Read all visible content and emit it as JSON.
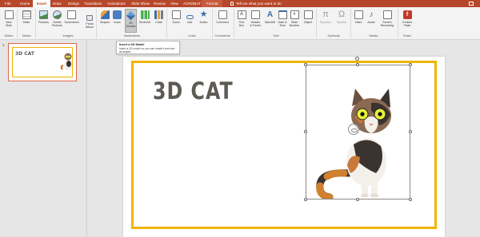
{
  "tabs": [
    {
      "label": "File",
      "active": false
    },
    {
      "label": "Home",
      "active": false
    },
    {
      "label": "Insert",
      "active": true
    },
    {
      "label": "Draw",
      "active": false
    },
    {
      "label": "Design",
      "active": false
    },
    {
      "label": "Transitions",
      "active": false
    },
    {
      "label": "Animations",
      "active": false
    },
    {
      "label": "Slide Show",
      "active": false
    },
    {
      "label": "Review",
      "active": false
    },
    {
      "label": "View",
      "active": false
    },
    {
      "label": "ACROBAT",
      "active": false
    },
    {
      "label": "Format",
      "active": false
    }
  ],
  "tell_me": "Tell me what you want to do",
  "ribbon": {
    "new_slide": "New\nSlide",
    "table": "Table",
    "pictures": "Pictures",
    "online_pictures": "Online\nPictures",
    "screenshot": "Screenshot",
    "photo_album": "Photo\nAlbum",
    "shapes": "Shapes",
    "icons": "Icons",
    "models_3d": "3D\nModels",
    "smartart": "SmartArt",
    "chart": "Chart",
    "zoom": "Zoom",
    "link": "Link",
    "action": "Action",
    "comment": "Comment",
    "text_box": "Text\nBox",
    "header_footer": "Header\n& Footer",
    "wordart": "WordArt",
    "date_time": "Date &\nTime",
    "slide_number": "Slide\nNumber",
    "object": "Object",
    "equation": "Equation",
    "symbol": "Symbol",
    "video": "Video",
    "audio": "Audio",
    "screen_recording": "Screen\nRecording",
    "embed_flash": "Embed\nFlash"
  },
  "groups": {
    "slides": "Slides",
    "tables": "Tables",
    "images": "Images",
    "illustrations": "Illustrations",
    "links": "Links",
    "comments": "Comments",
    "text": "Text",
    "symbols": "Symbols",
    "media": "Media",
    "flash": "Flash"
  },
  "tooltip": {
    "title": "Insert a 3D Model",
    "body": "Insert a 3D model so you can rotate it and see all angles."
  },
  "slide_panel": {
    "slide_number": "1",
    "thumbnail_title": "3D CAT"
  },
  "slide": {
    "title": "3D CAT"
  },
  "colors": {
    "accent": "#b7472a",
    "frame": "#f0b400",
    "title_text": "#5e5a55"
  }
}
